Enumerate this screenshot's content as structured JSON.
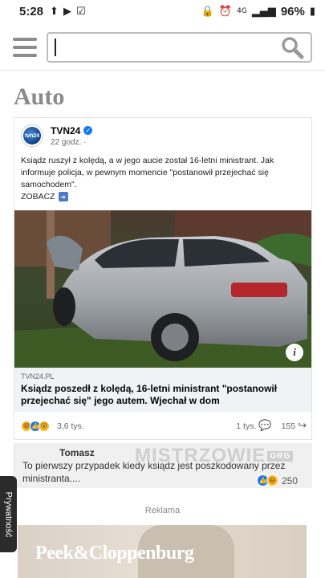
{
  "status_bar": {
    "time": "5:28",
    "network": "4G",
    "battery": "96%"
  },
  "search": {
    "placeholder": "",
    "value": ""
  },
  "section": {
    "title": "Auto"
  },
  "post": {
    "page_name": "TVN24",
    "avatar_text": "tvn24",
    "time": "22 godz. ·",
    "text": "Ksiądz ruszył z kolędą, a w jego aucie został 16-letni ministrant. Jak informuje policja, w pewnym momencie \"postanowił przejechać się samochodem\".",
    "see_more": "ZOBACZ",
    "link_domain": "TVN24.PL",
    "link_title": "Ksiądz poszedł z kolędą, 16-letni ministrant \"postanowił przejechać się\" jego autem. Wjechał w dom",
    "reactions_count": "3,6 tys.",
    "comments_count": "1 tys.",
    "shares_count": "155"
  },
  "comment": {
    "author": "Tomasz",
    "text": "To pierwszy przypadek kiedy ksiądz jest poszkodowany przez ministranta....",
    "reactions": "250",
    "watermark": "MISTRZOWIE",
    "watermark_suffix": "ORG"
  },
  "privacy_tab": {
    "label": "Prywatność"
  },
  "ad": {
    "label": "Reklama",
    "brand": "Peek&Cloppenburg"
  }
}
